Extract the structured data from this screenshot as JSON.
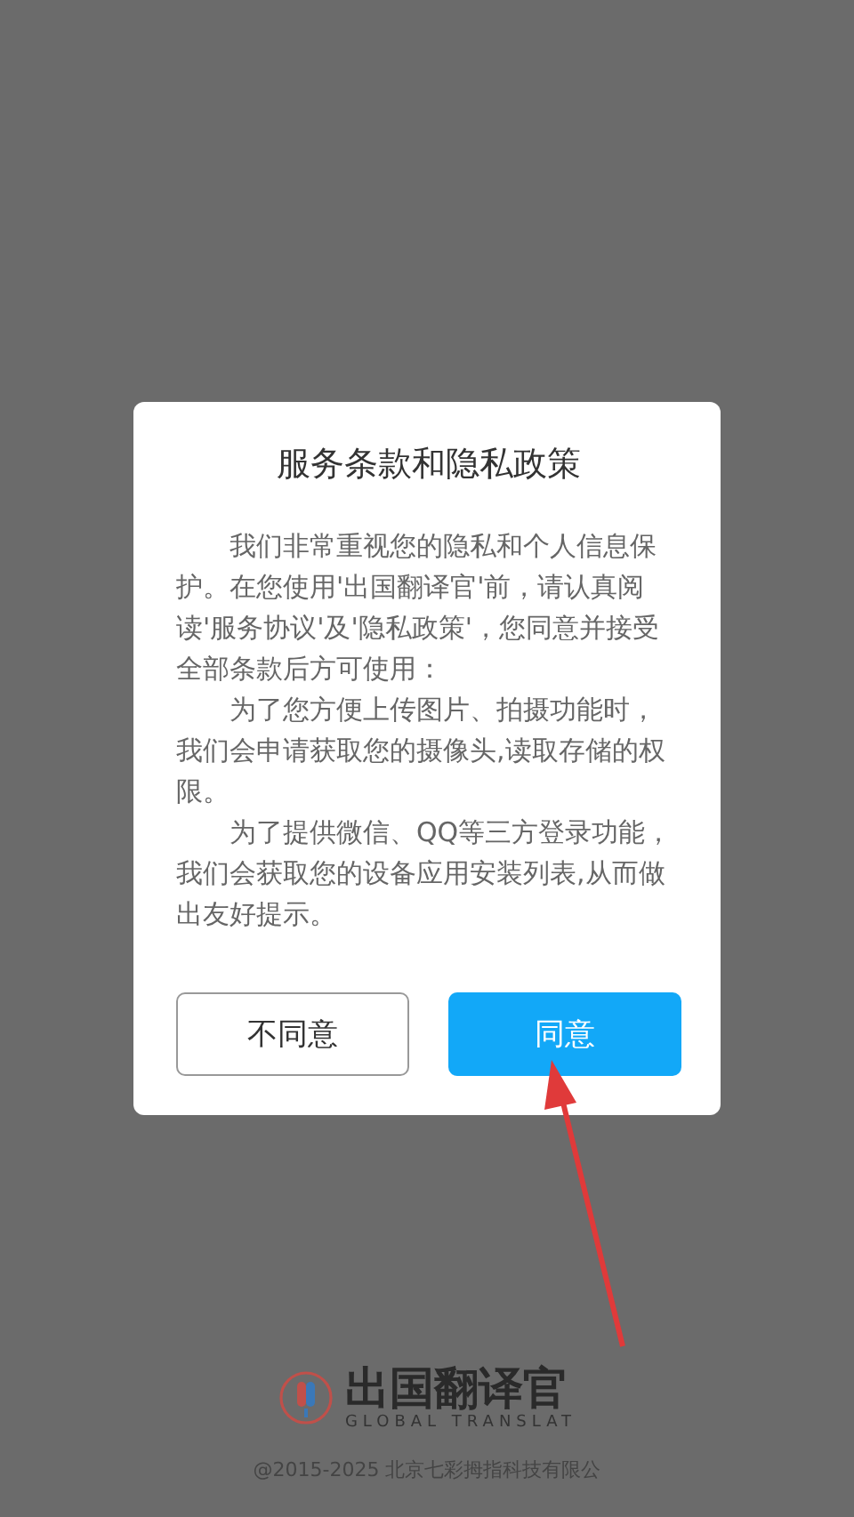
{
  "dialog": {
    "title": "服务条款和隐私政策",
    "paragraphs": [
      "我们非常重视您的隐私和个人信息保护。在您使用'出国翻译官'前，请认真阅读'服务协议'及'隐私政策'，您同意并接受全部条款后方可使用：",
      "为了您方便上传图片、拍摄功能时，我们会申请获取您的摄像头,读取存储的权限。",
      "为了提供微信、QQ等三方登录功能，我们会获取您的设备应用安装列表,从而做出友好提示。"
    ],
    "buttons": [
      {
        "label": "不同意",
        "kind": "secondary"
      },
      {
        "label": "同意",
        "kind": "primary"
      }
    ]
  },
  "brand": {
    "name": "出国翻译官",
    "tagline": "GLOBAL TRANSLAT"
  },
  "copyright": "@2015-2025 北京七彩拇指科技有限公"
}
